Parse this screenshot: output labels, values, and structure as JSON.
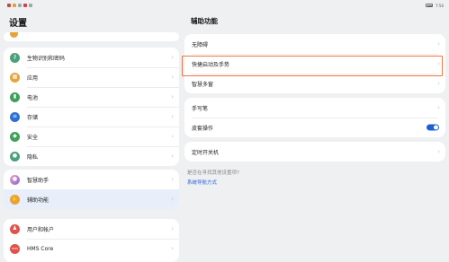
{
  "statusbar": {
    "time": "7:56"
  },
  "left": {
    "title": "设置",
    "items": [
      {
        "label": "生物识别和密码",
        "icon": "key-icon",
        "color": "#4aa079"
      },
      {
        "label": "应用",
        "icon": "apps-icon",
        "color": "#e8a23a"
      },
      {
        "label": "电池",
        "icon": "battery-icon",
        "color": "#3fa05b"
      },
      {
        "label": "存储",
        "icon": "storage-icon",
        "color": "#2f6fd3"
      },
      {
        "label": "安全",
        "icon": "shield-icon",
        "color": "#3fa05b"
      },
      {
        "label": "隐私",
        "icon": "privacy-icon",
        "color": "#4aa079"
      },
      {
        "label": "智慧助手",
        "icon": "assistant-icon",
        "color": "#8c6ad6"
      },
      {
        "label": "辅助功能",
        "icon": "hand-icon",
        "color": "#e8a23a"
      },
      {
        "label": "用户和帐户",
        "icon": "user-icon",
        "color": "#e0524a"
      },
      {
        "label": "HMS Core",
        "icon": "hms-icon",
        "color": "#e0524a"
      }
    ]
  },
  "right": {
    "title": "辅助功能",
    "items": [
      {
        "label": "无障碍"
      },
      {
        "label": "快捷启动及手势"
      },
      {
        "label": "智慧多窗"
      },
      {
        "label": "手写笔"
      },
      {
        "label": "皮套操作",
        "toggle": true
      },
      {
        "label": "定时开关机"
      }
    ],
    "suggest_question": "是否在寻找其他设置项?",
    "suggest_link": "系统导航方式"
  },
  "colors": {
    "accent": "#1f5fd6",
    "highlight": "#f0743e"
  }
}
